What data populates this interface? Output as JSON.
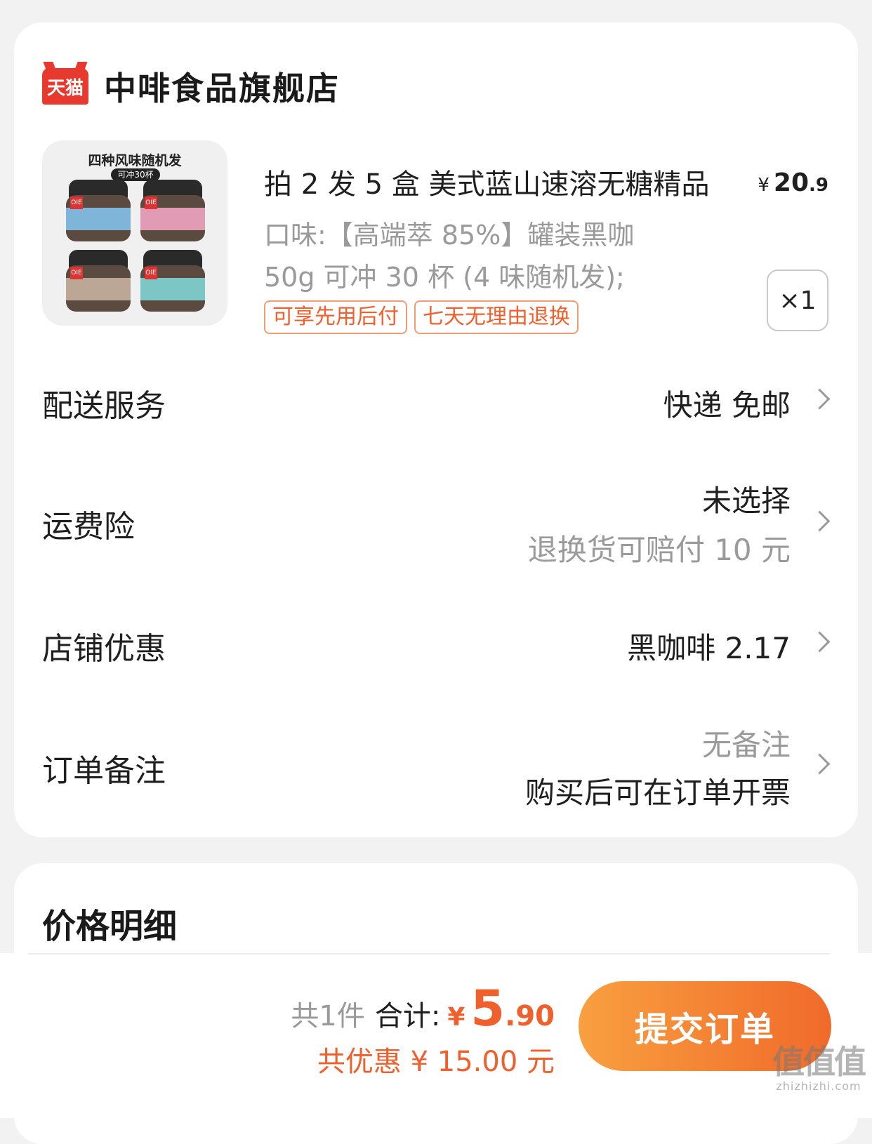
{
  "shop": {
    "badge": "天猫",
    "name": "中啡食品旗舰店"
  },
  "product": {
    "image": {
      "title": "四种风味随机发",
      "subtitle": "可冲30杯",
      "logo": "OIE",
      "jar_colors": [
        "#7fb5d8",
        "#e29bb5",
        "#bca696",
        "#7cc6c6"
      ]
    },
    "title": "拍 2 发 5 盒 美式蓝山速溶无糖精品",
    "price": {
      "currency": "¥",
      "integer": "20",
      "decimal": ".9"
    },
    "spec_line1": "口味:【高端萃 85%】罐装黑咖",
    "spec_line2": "50g 可冲 30 杯 (4 味随机发);",
    "tags": [
      "可享先用后付",
      "七天无理由退换"
    ],
    "quantity": "×1"
  },
  "rows": {
    "delivery": {
      "label": "配送服务",
      "value": "快递 免邮"
    },
    "insurance": {
      "label": "运费险",
      "value": "未选择",
      "note": "退换货可赔付 10 元"
    },
    "discount": {
      "label": "店铺优惠",
      "value": "黑咖啡 2.17"
    },
    "remark": {
      "label": "订单备注",
      "value": "无备注",
      "note": "购买后可在订单开票"
    }
  },
  "price_detail": {
    "title": "价格明细"
  },
  "footer": {
    "count": "共1件",
    "total_label": "合计:",
    "currency": "¥",
    "total_integer": "5",
    "total_decimal": ".90",
    "saving": "共优惠 ¥ 15.00 元",
    "submit": "提交订单"
  },
  "watermark": {
    "text": "值值值",
    "url": "zhizhizhi.com"
  },
  "colors": {
    "accent": "#f0602d",
    "tmall": "#e8392f",
    "button_start": "#f8a040",
    "button_end": "#f06a2a"
  }
}
